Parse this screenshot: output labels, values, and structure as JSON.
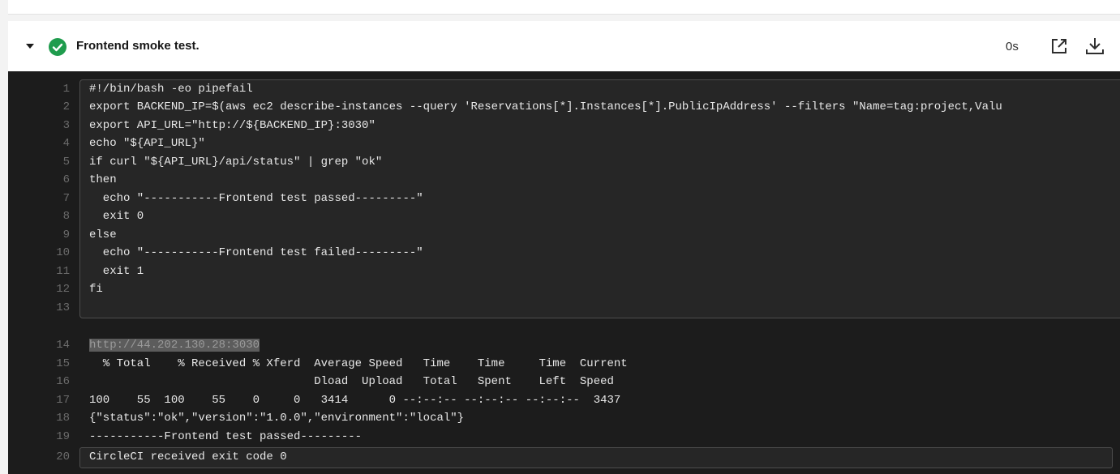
{
  "step": {
    "title": "Frontend smoke test.",
    "duration": "0s",
    "status": "success",
    "status_color": "#1f9c4d"
  },
  "script_lines": [
    {
      "num": "1",
      "text": "#!/bin/bash -eo pipefail"
    },
    {
      "num": "2",
      "text": "export BACKEND_IP=$(aws ec2 describe-instances --query 'Reservations[*].Instances[*].PublicIpAddress' --filters \"Name=tag:project,Valu"
    },
    {
      "num": "3",
      "text": "export API_URL=\"http://${BACKEND_IP}:3030\""
    },
    {
      "num": "4",
      "text": "echo \"${API_URL}\""
    },
    {
      "num": "5",
      "text": "if curl \"${API_URL}/api/status\" | grep \"ok\""
    },
    {
      "num": "6",
      "text": "then"
    },
    {
      "num": "7",
      "text": "  echo \"-----------Frontend test passed---------\""
    },
    {
      "num": "8",
      "text": "  exit 0"
    },
    {
      "num": "9",
      "text": "else"
    },
    {
      "num": "10",
      "text": "  echo \"-----------Frontend test failed---------\""
    },
    {
      "num": "11",
      "text": "  exit 1"
    },
    {
      "num": "12",
      "text": "fi"
    },
    {
      "num": "13",
      "text": ""
    }
  ],
  "output_lines": [
    {
      "num": "14",
      "text": "http://44.202.130.28:3030"
    },
    {
      "num": "15",
      "text": "  % Total    % Received % Xferd  Average Speed   Time    Time     Time  Current"
    },
    {
      "num": "16",
      "text": "                                 Dload  Upload   Total   Spent    Left  Speed"
    },
    {
      "num": "17",
      "text": "100    55  100    55    0     0   3414      0 --:--:-- --:--:-- --:--:--  3437"
    },
    {
      "num": "18",
      "text": "{\"status\":\"ok\",\"version\":\"1.0.0\",\"environment\":\"local\"}"
    },
    {
      "num": "19",
      "text": "-----------Frontend test passed---------"
    },
    {
      "num": "20",
      "text": "CircleCI received exit code 0"
    }
  ],
  "icons": {
    "caret": "chevron-down-icon",
    "status": "check-circle-icon",
    "external": "external-link-icon",
    "download": "download-icon"
  }
}
